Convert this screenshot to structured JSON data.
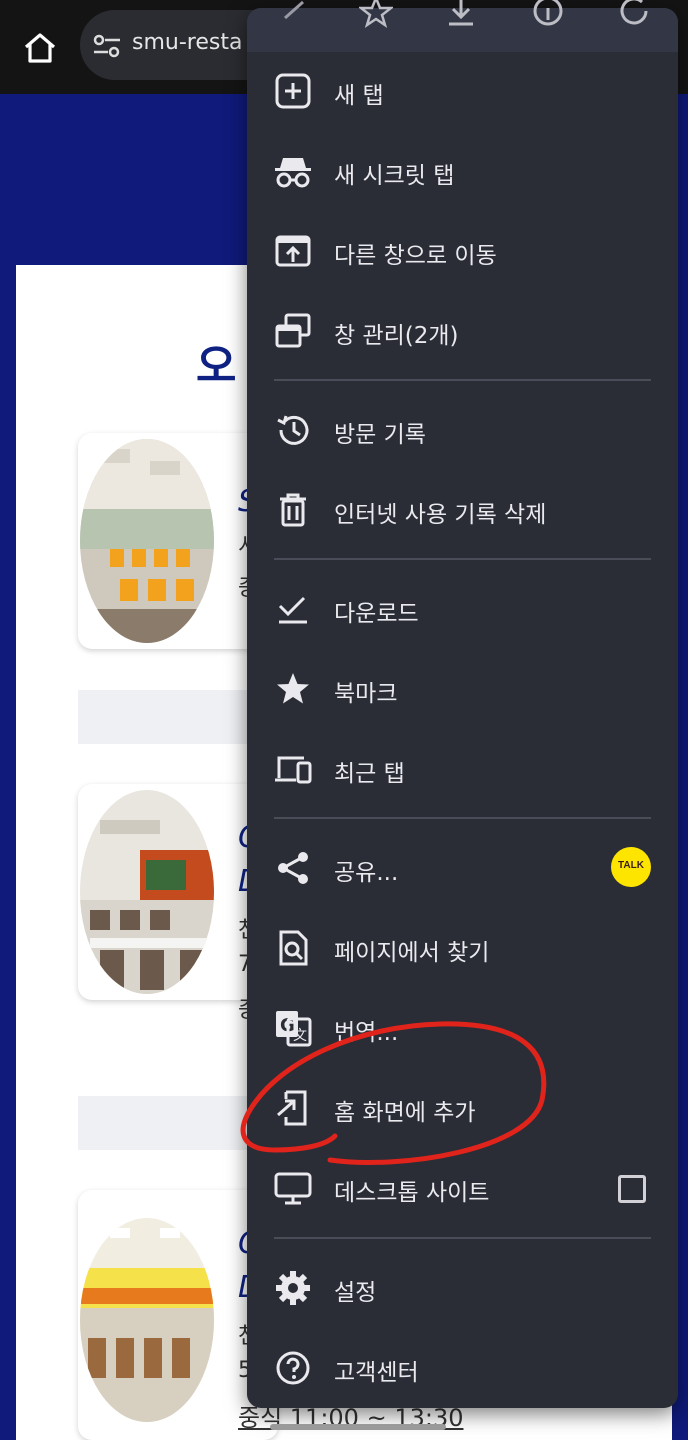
{
  "browser": {
    "url_text": "smu-resta"
  },
  "page": {
    "title_fragment": "오",
    "cards": [
      {
        "fragments": [
          "S",
          "서",
          "중"
        ]
      },
      {
        "fragments": [
          "C",
          "D",
          "천",
          "7",
          "중"
        ]
      },
      {
        "fragments": [
          "C",
          "D",
          "천",
          "5"
        ]
      }
    ],
    "hours_text": "중식 11:00 ~ 13:30"
  },
  "menu": {
    "items": [
      {
        "label": "새 탭",
        "icon": "new-tab-icon"
      },
      {
        "label": "새 시크릿 탭",
        "icon": "incognito-icon"
      },
      {
        "label": "다른 창으로 이동",
        "icon": "move-to-window-icon"
      },
      {
        "label": "창 관리(2개)",
        "icon": "manage-windows-icon"
      },
      {
        "label": "방문 기록",
        "icon": "history-icon"
      },
      {
        "label": "인터넷 사용 기록 삭제",
        "icon": "trash-icon"
      },
      {
        "label": "다운로드",
        "icon": "download-check-icon"
      },
      {
        "label": "북마크",
        "icon": "star-icon"
      },
      {
        "label": "최근 탭",
        "icon": "devices-icon"
      },
      {
        "label": "공유...",
        "icon": "share-icon"
      },
      {
        "label": "페이지에서 찾기",
        "icon": "find-in-page-icon"
      },
      {
        "label": "번역...",
        "icon": "translate-icon"
      },
      {
        "label": "홈 화면에 추가",
        "icon": "add-to-home-icon"
      },
      {
        "label": "데스크톱 사이트",
        "icon": "monitor-icon"
      },
      {
        "label": "설정",
        "icon": "gear-icon"
      },
      {
        "label": "고객센터",
        "icon": "help-icon"
      }
    ],
    "share_app_badge": "TALK",
    "desktop_site_checked": false
  },
  "colors": {
    "menu_bg": "#2a2c36",
    "page_bg": "#0f1a7a",
    "annotation": "#e0241b",
    "kakao_yellow": "#fee500"
  }
}
